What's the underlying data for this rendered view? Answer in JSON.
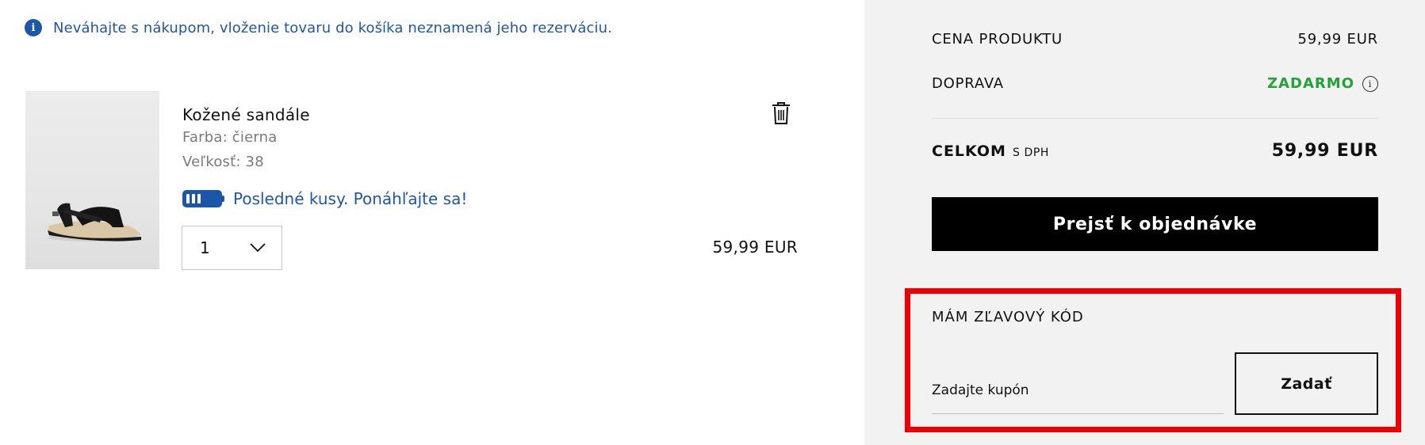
{
  "notice": {
    "icon": "info-icon",
    "text": "Neváhajte s nákupom, vloženie tovaru do košíka neznamená jeho rezerváciu."
  },
  "cart_item": {
    "name": "Kožené sandále",
    "color": "Farba: čierna",
    "size": "Veľkosť: 38",
    "stock_message": "Posledné kusy. Ponáhľajte sa!",
    "quantity": "1",
    "price": "59,99 EUR",
    "delete_icon": "trash-icon"
  },
  "summary": {
    "product_price_label": "CENA PRODUKTU",
    "product_price_value": "59,99 EUR",
    "shipping_label": "DOPRAVA",
    "shipping_value": "ZADARMO",
    "total_label": "CELKOM",
    "total_sublabel": "S DPH",
    "total_value": "59,99 EUR",
    "checkout_button": "Prejsť k objednávke"
  },
  "coupon": {
    "title": "MÁM ZĽAVOVÝ KÓD",
    "placeholder": "Zadajte kupón",
    "submit": "Zadať"
  },
  "colors": {
    "brand_blue": "#1c56a9",
    "free_green": "#23a23a",
    "highlight_red": "#ee0000",
    "panel_bg": "#f2f2f3"
  }
}
